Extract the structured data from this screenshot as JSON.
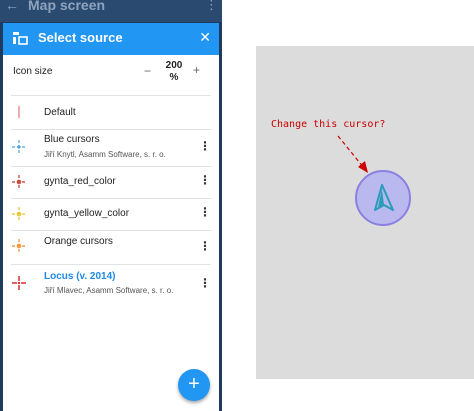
{
  "appbar": {
    "title": "Map screen"
  },
  "dialog": {
    "title": "Select source",
    "icon_size_label": "Icon size",
    "icon_size_value": "200\n%",
    "items": [
      {
        "name": "Default",
        "author": "",
        "color": "#e57373",
        "highlight": false
      },
      {
        "name": "Blue cursors",
        "author": "Jiří Knytl, Asamm Software, s. r. o.",
        "color": "#4aa3df",
        "highlight": false
      },
      {
        "name": "gynta_red_color",
        "author": "",
        "color": "#c0392b",
        "highlight": false
      },
      {
        "name": "gynta_yellow_color",
        "author": "",
        "color": "#e6c020",
        "highlight": false
      },
      {
        "name": "Orange cursors",
        "author": "",
        "color": "#f08a24",
        "highlight": false
      },
      {
        "name": "Locus (v. 2014)",
        "author": "Jiří Mlavec, Asamm Software, s. r. o.",
        "color": "#d32f2f",
        "highlight": true
      }
    ]
  },
  "preview": {
    "callout": "Change this cursor?",
    "accent": "#2a9bb8"
  }
}
